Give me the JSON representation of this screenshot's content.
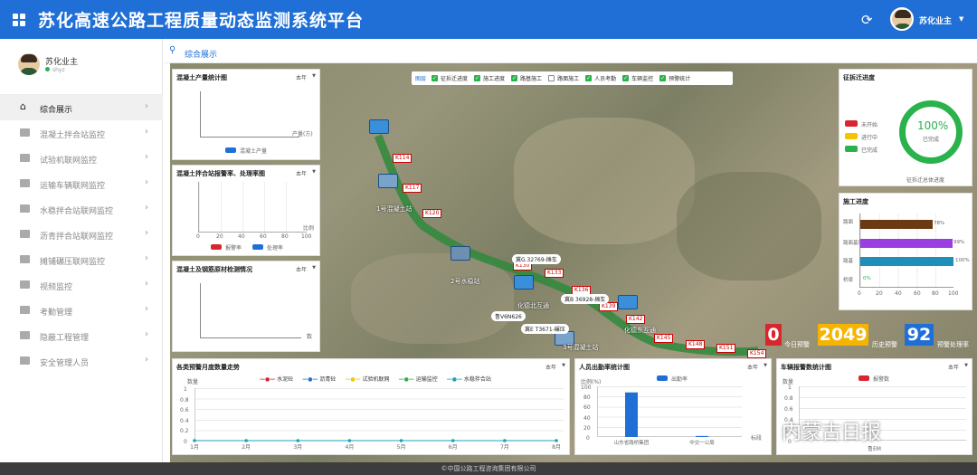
{
  "header": {
    "title": "苏化高速公路工程质量动态监测系统平台",
    "user": "苏化业主"
  },
  "sidebar": {
    "user": {
      "name": "苏化业主",
      "status": "shyz"
    },
    "items": [
      {
        "label": "综合展示",
        "active": true
      },
      {
        "label": "混凝土拌合站监控"
      },
      {
        "label": "试验机联网监控"
      },
      {
        "label": "运输车辆联网监控"
      },
      {
        "label": "水稳拌合站联网监控"
      },
      {
        "label": "沥青拌合站联网监控"
      },
      {
        "label": "摊铺碾压联网监控"
      },
      {
        "label": "视频监控"
      },
      {
        "label": "考勤管理"
      },
      {
        "label": "隐蔽工程管理"
      },
      {
        "label": "安全管理人员"
      }
    ]
  },
  "breadcrumb": "综合展示",
  "layers": {
    "title": "图层",
    "items": [
      {
        "label": "征拆迁进度",
        "checked": true
      },
      {
        "label": "施工进度",
        "checked": true
      },
      {
        "label": "路基施工",
        "checked": true
      },
      {
        "label": "路面施工",
        "checked": false
      },
      {
        "label": "人员考勤",
        "checked": true
      },
      {
        "label": "车辆监控",
        "checked": true
      },
      {
        "label": "预警统计",
        "checked": true
      }
    ]
  },
  "panels": {
    "concrete_output": {
      "title": "混凝土产量统计图",
      "period": "本年",
      "axis_label": "产量(方)",
      "legend": "混凝土产量"
    },
    "mix_alarm": {
      "title": "混凝土拌合站报警率、处理率图",
      "period": "本年",
      "axis_label": "比例",
      "ticks": [
        "0",
        "20",
        "40",
        "60",
        "80",
        "100"
      ],
      "legend": [
        "报警率",
        "处理率"
      ]
    },
    "steel_test": {
      "title": "混凝土及钢筋原材检测情况",
      "period": "本年",
      "axis_label": "数"
    },
    "demolition": {
      "title": "征拆迁进度",
      "legend": [
        "未开始",
        "进行中",
        "已完成"
      ],
      "percent": "100%",
      "percent_label": "已完成",
      "caption": "征拆迁总体进度"
    },
    "construction": {
      "title": "施工进度",
      "rows": [
        {
          "label": "路面",
          "value": 78,
          "text": "78%"
        },
        {
          "label": "路面基层",
          "value": 99,
          "text": "99%"
        },
        {
          "label": "路基",
          "value": 100,
          "text": "100%"
        },
        {
          "label": "桥梁",
          "value": 0,
          "text": "0%"
        }
      ],
      "ticks": [
        "0",
        "20",
        "40",
        "60",
        "80",
        "100"
      ]
    },
    "warning_trend": {
      "title": "各类预警月度数量走势",
      "period": "本年",
      "y_label": "数量",
      "legend": [
        "水泥砼",
        "沥青砼",
        "试验机联网",
        "运输监控",
        "水稳拌合站"
      ],
      "months": [
        "1月",
        "2月",
        "3月",
        "4月",
        "5月",
        "6月",
        "7月",
        "8月"
      ],
      "y_ticks": [
        "1",
        "0.8",
        "0.6",
        "0.4",
        "0.2",
        "0"
      ]
    },
    "attendance": {
      "title": "人员出勤率统计图",
      "period": "本年",
      "y_label": "比例(%)",
      "legend": "出勤率",
      "x_label": "标段",
      "y_ticks": [
        "100",
        "80",
        "60",
        "40",
        "20",
        "0"
      ],
      "categories": [
        "山东省路桥集团",
        "中交一公局"
      ]
    },
    "vehicle_alarm": {
      "title": "车辆报警数统计图",
      "period": "本年",
      "y_label": "数量",
      "legend": "报警数",
      "y_ticks": [
        "1",
        "0.8",
        "0.6",
        "0.4",
        "0.2",
        "0"
      ],
      "category": "鲁EM"
    }
  },
  "chart_data": [
    {
      "type": "bar",
      "title": "人员出勤率统计图",
      "categories": [
        "山东省路桥集团",
        "中交一公局"
      ],
      "series": [
        {
          "name": "出勤率",
          "values": [
            88,
            2
          ]
        }
      ],
      "ylabel": "比例(%)",
      "xlabel": "标段",
      "ylim": [
        0,
        100
      ]
    },
    {
      "type": "line",
      "title": "各类预警月度数量走势",
      "categories": [
        "1月",
        "2月",
        "3月",
        "4月",
        "5月",
        "6月",
        "7月",
        "8月"
      ],
      "series": [
        {
          "name": "水泥砼",
          "values": [
            0,
            0,
            0,
            0,
            0,
            0,
            0,
            0
          ]
        }
      ],
      "ylabel": "数量",
      "ylim": [
        0,
        1
      ]
    }
  ],
  "stats": [
    {
      "value": "0",
      "label": "今日预警",
      "color": "#d8262f"
    },
    {
      "value": "2049",
      "label": "历史预警",
      "color": "#f5b400"
    },
    {
      "value": "92",
      "label": "预警处理率",
      "color": "#1f6fd6"
    }
  ],
  "map": {
    "sites": [
      "1号混凝土站",
      "2号水稳站",
      "化德北互通",
      "化德东互通",
      "3号混凝土站"
    ],
    "markers": [
      "K114",
      "K117",
      "K120",
      "K130",
      "K133",
      "K136",
      "K139",
      "K142",
      "K145",
      "K148",
      "K151",
      "K154"
    ],
    "plates": [
      "冀G.32769-摊车",
      "冀B 36928-摊车",
      "冀E T3671-碾压",
      "鲁V6N626"
    ]
  },
  "watermark": "内蒙古日报",
  "footer": "©中国公路工程咨询集团有限公司"
}
